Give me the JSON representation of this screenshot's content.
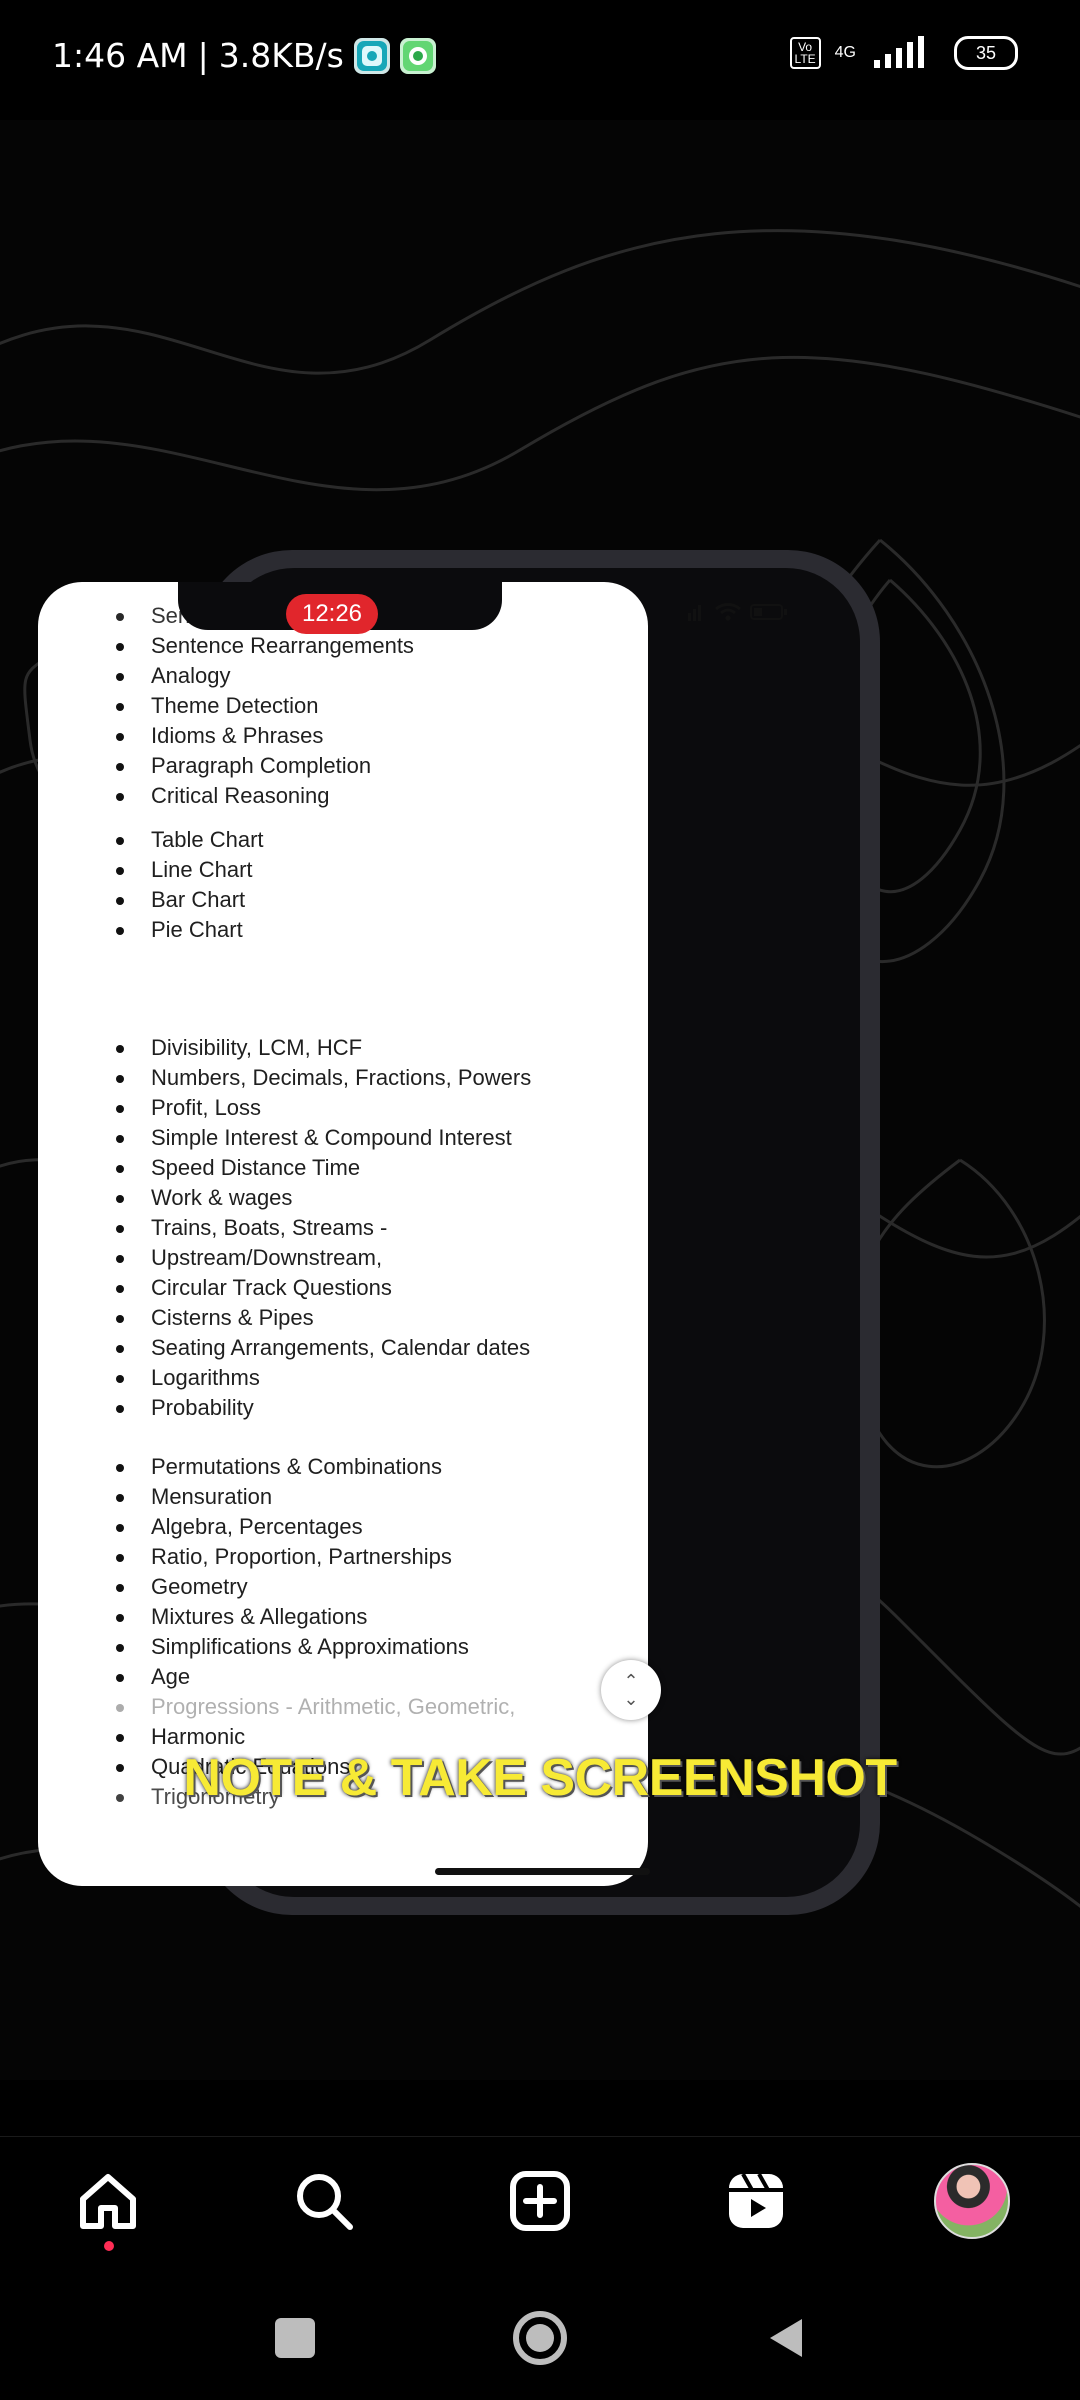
{
  "status_bar": {
    "time": "1:46 AM",
    "separator": "|",
    "network_speed": "3.8KB/s",
    "volte": "Vo\nLTE",
    "network_type": "4G",
    "battery": "35"
  },
  "reel": {
    "phone_time": "12:26",
    "overlay_text": "NOTE & TAKE SCREENSHOT",
    "sections": [
      {
        "items": [
          "Sentence Improvements",
          "Sentence Rearrangements",
          "Analogy",
          "Theme Detection",
          "Idioms & Phrases",
          "Paragraph Completion",
          "Critical Reasoning"
        ]
      },
      {
        "items": [
          "Table Chart",
          "Line Chart",
          "Bar Chart",
          "Pie Chart"
        ]
      },
      {
        "items": [
          "Divisibility, LCM, HCF",
          "Numbers, Decimals, Fractions, Powers",
          "Profit, Loss",
          "Simple Interest & Compound Interest",
          "Speed Distance Time",
          "Work & wages",
          "Trains, Boats, Streams -",
          "Upstream/Downstream,",
          "Circular Track Questions",
          "Cisterns & Pipes",
          "Seating Arrangements, Calendar dates",
          "Logarithms",
          "Probability"
        ]
      },
      {
        "items": [
          "Permutations & Combinations",
          "Mensuration",
          "Algebra, Percentages",
          " Ratio, Proportion, Partnerships",
          "Geometry",
          " Mixtures & Allegations",
          "Simplifications & Approximations",
          "Age",
          "Progressions - Arithmetic, Geometric,",
          "Harmonic",
          "Quadratic Equations",
          "Trigonometry"
        ]
      }
    ]
  },
  "bottom_nav": {
    "icons": [
      "home-icon",
      "search-icon",
      "create-icon",
      "reels-icon",
      "profile-avatar"
    ]
  },
  "system_nav": {
    "icons": [
      "recents-icon",
      "home-icon",
      "back-icon"
    ]
  }
}
